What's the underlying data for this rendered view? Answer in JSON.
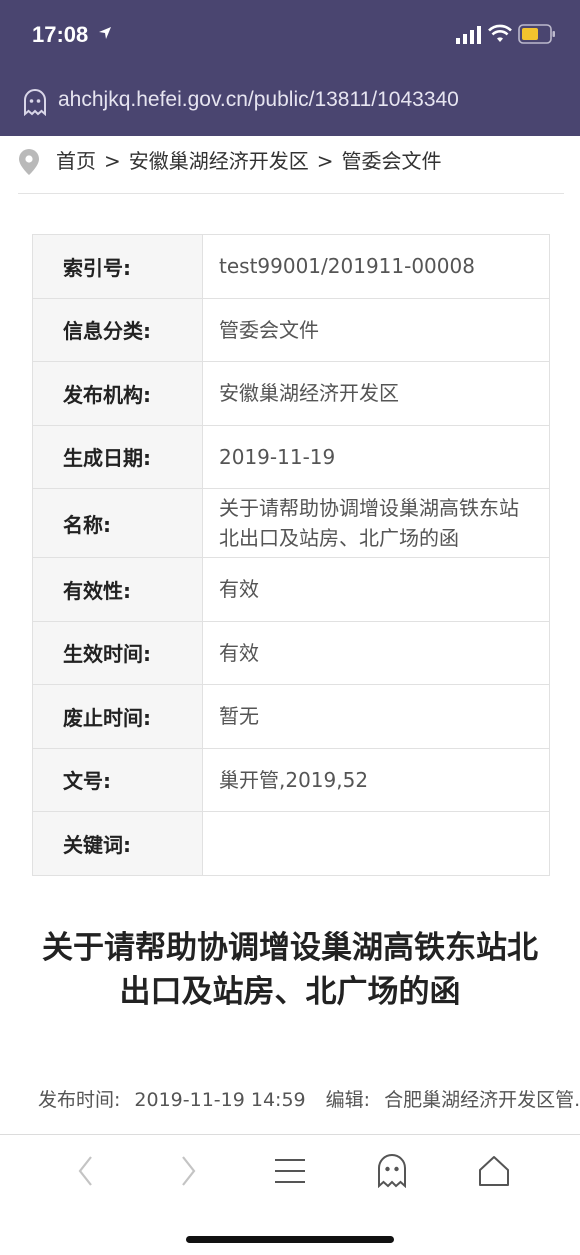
{
  "status": {
    "time": "17:08"
  },
  "browser": {
    "url": "ahchjkq.hefei.gov.cn/public/13811/1043340"
  },
  "breadcrumb": {
    "home": "首页",
    "section": "安徽巢湖经济开发区",
    "current": "管委会文件",
    "separator": ">"
  },
  "meta": [
    {
      "key": "索引号:",
      "value": "test99001/201911-00008"
    },
    {
      "key": "信息分类:",
      "value": "管委会文件"
    },
    {
      "key": "发布机构:",
      "value": "安徽巢湖经济开发区"
    },
    {
      "key": "生成日期:",
      "value": "2019-11-19"
    },
    {
      "key": "名称:",
      "value": "关于请帮助协调增设巢湖高铁东站北出口及站房、北广场的函"
    },
    {
      "key": "有效性:",
      "value": "有效"
    },
    {
      "key": "生效时间:",
      "value": "有效"
    },
    {
      "key": "废止时间:",
      "value": "暂无"
    },
    {
      "key": "文号:",
      "value": "巢开管,2019,52"
    },
    {
      "key": "关键词:",
      "value": ""
    }
  ],
  "article": {
    "title": "关于请帮助协调增设巢湖高铁东站北出口及站房、北广场的函",
    "publish_label": "发布时间:",
    "publish_time": "2019-11-19 14:59",
    "editor_label": "编辑:",
    "editor": "合肥巢湖经济开发区管..."
  },
  "toolbar": {
    "icons": [
      "back-icon",
      "forward-icon",
      "menu-icon",
      "ghost-icon",
      "home-icon"
    ]
  }
}
